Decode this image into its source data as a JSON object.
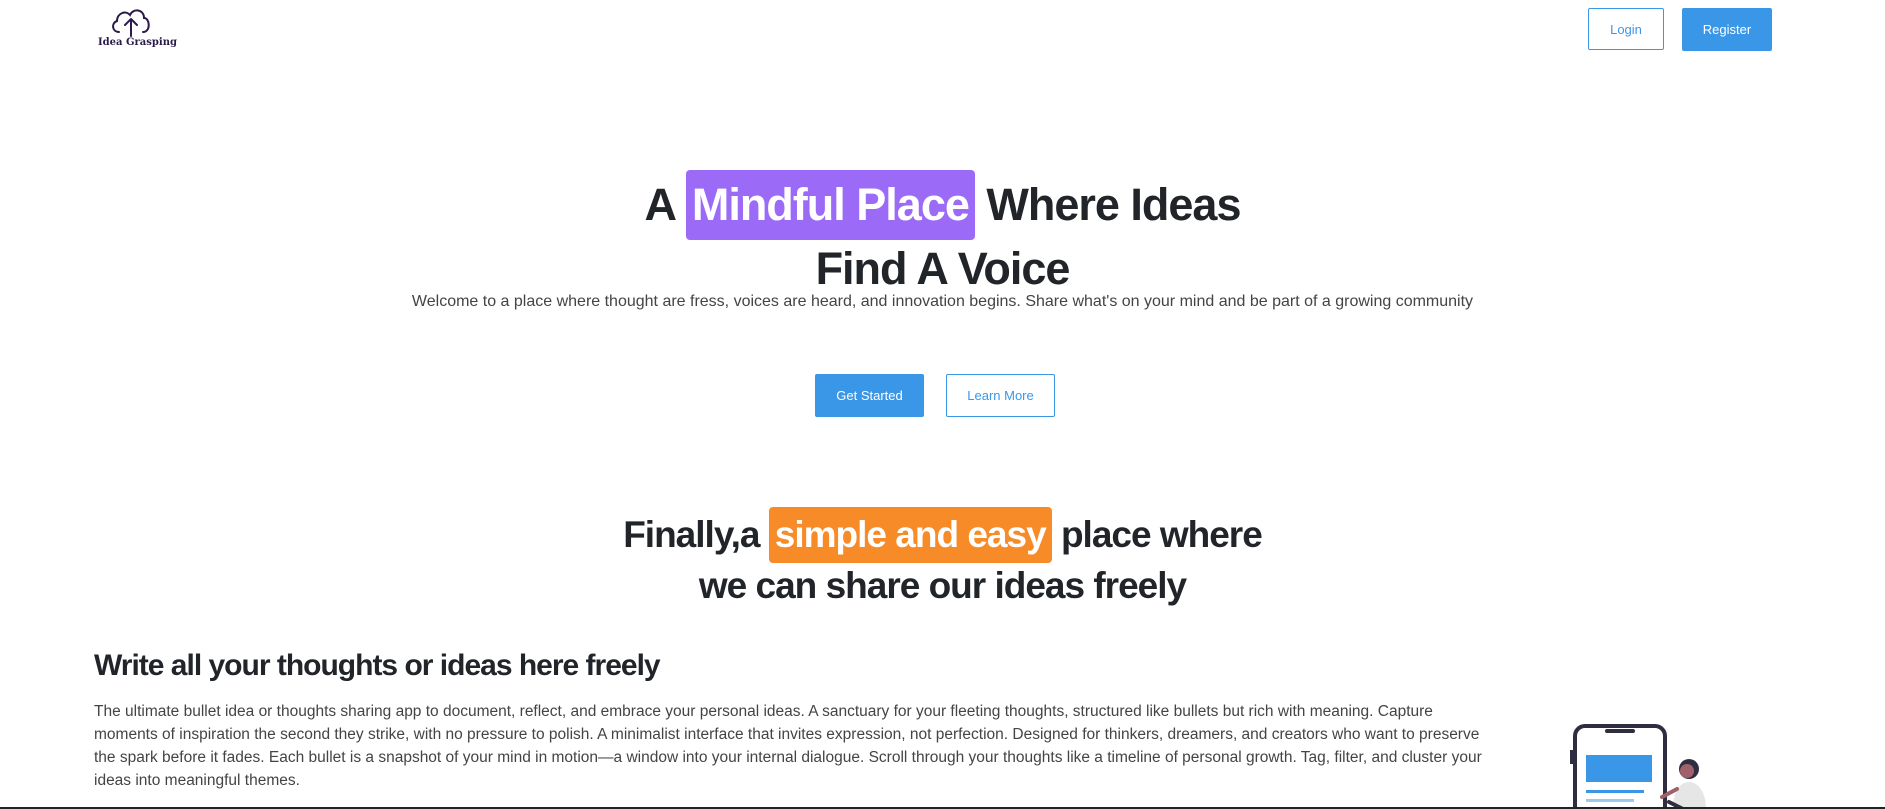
{
  "brand": {
    "name": "Idea Grasping",
    "logo_icon": "cloud-upload-icon",
    "color": "#2b1a4a"
  },
  "nav": {
    "login_label": "Login",
    "register_label": "Register"
  },
  "hero": {
    "title_prefix": "A",
    "title_highlight": "Mindful Place",
    "title_suffix": "Where Ideas",
    "title_line2": "Find A Voice",
    "subtitle": "Welcome to a place where thought are fress, voices are heard, and innovation begins. Share what's on your mind and be part of a growing community",
    "cta_primary": "Get Started",
    "cta_secondary": "Learn More"
  },
  "section": {
    "title_prefix": "Finally,a",
    "title_highlight": "simple and easy",
    "title_suffix": "place where",
    "title_line2": "we can share our ideas freely"
  },
  "feature": {
    "title": "Write all your thoughts or ideas here freely",
    "description": "The ultimate bullet idea or thoughts sharing app to document, reflect, and embrace your personal ideas. A sanctuary for your fleeting thoughts, structured like bullets but rich with meaning. Capture moments of inspiration the second they strike, with no pressure to polish. A minimalist interface that invites expression, not perfection. Designed for thinkers, dreamers, and creators who want to preserve the spark before it fades. Each bullet is a snapshot of your mind in motion—a window into your internal dialogue. Scroll through your thoughts like a timeline of personal growth. Tag, filter, and cluster your ideas into meaningful themes.",
    "illustration_icon": "phone-with-person-illustration"
  },
  "colors": {
    "accent": "#3a97e8",
    "highlight_purple": "#9b6bf7",
    "highlight_orange": "#f78b27",
    "text": "#212529"
  }
}
